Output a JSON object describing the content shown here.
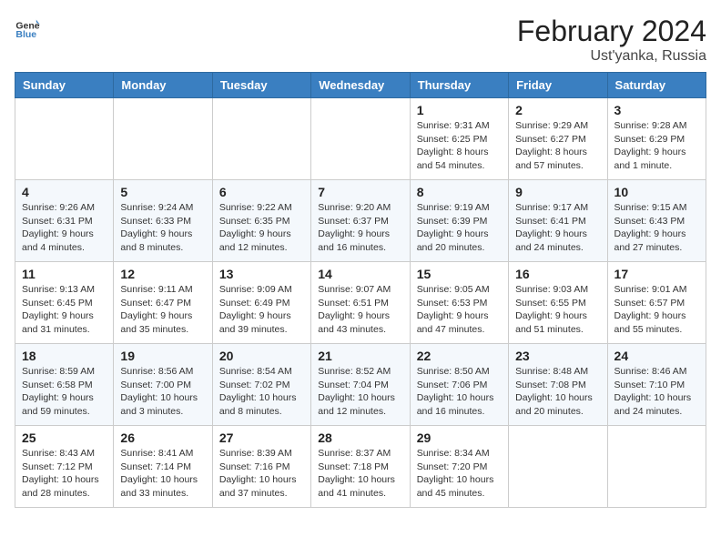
{
  "header": {
    "logo": {
      "general": "General",
      "blue": "Blue"
    },
    "title": "February 2024",
    "subtitle": "Ust'yanka, Russia"
  },
  "days_of_week": [
    "Sunday",
    "Monday",
    "Tuesday",
    "Wednesday",
    "Thursday",
    "Friday",
    "Saturday"
  ],
  "weeks": [
    [
      {
        "date": "",
        "sunrise": "",
        "sunset": "",
        "daylight": ""
      },
      {
        "date": "",
        "sunrise": "",
        "sunset": "",
        "daylight": ""
      },
      {
        "date": "",
        "sunrise": "",
        "sunset": "",
        "daylight": ""
      },
      {
        "date": "",
        "sunrise": "",
        "sunset": "",
        "daylight": ""
      },
      {
        "date": "1",
        "sunrise": "9:31 AM",
        "sunset": "6:25 PM",
        "daylight": "8 hours and 54 minutes."
      },
      {
        "date": "2",
        "sunrise": "9:29 AM",
        "sunset": "6:27 PM",
        "daylight": "8 hours and 57 minutes."
      },
      {
        "date": "3",
        "sunrise": "9:28 AM",
        "sunset": "6:29 PM",
        "daylight": "9 hours and 1 minute."
      }
    ],
    [
      {
        "date": "4",
        "sunrise": "9:26 AM",
        "sunset": "6:31 PM",
        "daylight": "9 hours and 4 minutes."
      },
      {
        "date": "5",
        "sunrise": "9:24 AM",
        "sunset": "6:33 PM",
        "daylight": "9 hours and 8 minutes."
      },
      {
        "date": "6",
        "sunrise": "9:22 AM",
        "sunset": "6:35 PM",
        "daylight": "9 hours and 12 minutes."
      },
      {
        "date": "7",
        "sunrise": "9:20 AM",
        "sunset": "6:37 PM",
        "daylight": "9 hours and 16 minutes."
      },
      {
        "date": "8",
        "sunrise": "9:19 AM",
        "sunset": "6:39 PM",
        "daylight": "9 hours and 20 minutes."
      },
      {
        "date": "9",
        "sunrise": "9:17 AM",
        "sunset": "6:41 PM",
        "daylight": "9 hours and 24 minutes."
      },
      {
        "date": "10",
        "sunrise": "9:15 AM",
        "sunset": "6:43 PM",
        "daylight": "9 hours and 27 minutes."
      }
    ],
    [
      {
        "date": "11",
        "sunrise": "9:13 AM",
        "sunset": "6:45 PM",
        "daylight": "9 hours and 31 minutes."
      },
      {
        "date": "12",
        "sunrise": "9:11 AM",
        "sunset": "6:47 PM",
        "daylight": "9 hours and 35 minutes."
      },
      {
        "date": "13",
        "sunrise": "9:09 AM",
        "sunset": "6:49 PM",
        "daylight": "9 hours and 39 minutes."
      },
      {
        "date": "14",
        "sunrise": "9:07 AM",
        "sunset": "6:51 PM",
        "daylight": "9 hours and 43 minutes."
      },
      {
        "date": "15",
        "sunrise": "9:05 AM",
        "sunset": "6:53 PM",
        "daylight": "9 hours and 47 minutes."
      },
      {
        "date": "16",
        "sunrise": "9:03 AM",
        "sunset": "6:55 PM",
        "daylight": "9 hours and 51 minutes."
      },
      {
        "date": "17",
        "sunrise": "9:01 AM",
        "sunset": "6:57 PM",
        "daylight": "9 hours and 55 minutes."
      }
    ],
    [
      {
        "date": "18",
        "sunrise": "8:59 AM",
        "sunset": "6:58 PM",
        "daylight": "9 hours and 59 minutes."
      },
      {
        "date": "19",
        "sunrise": "8:56 AM",
        "sunset": "7:00 PM",
        "daylight": "10 hours and 3 minutes."
      },
      {
        "date": "20",
        "sunrise": "8:54 AM",
        "sunset": "7:02 PM",
        "daylight": "10 hours and 8 minutes."
      },
      {
        "date": "21",
        "sunrise": "8:52 AM",
        "sunset": "7:04 PM",
        "daylight": "10 hours and 12 minutes."
      },
      {
        "date": "22",
        "sunrise": "8:50 AM",
        "sunset": "7:06 PM",
        "daylight": "10 hours and 16 minutes."
      },
      {
        "date": "23",
        "sunrise": "8:48 AM",
        "sunset": "7:08 PM",
        "daylight": "10 hours and 20 minutes."
      },
      {
        "date": "24",
        "sunrise": "8:46 AM",
        "sunset": "7:10 PM",
        "daylight": "10 hours and 24 minutes."
      }
    ],
    [
      {
        "date": "25",
        "sunrise": "8:43 AM",
        "sunset": "7:12 PM",
        "daylight": "10 hours and 28 minutes."
      },
      {
        "date": "26",
        "sunrise": "8:41 AM",
        "sunset": "7:14 PM",
        "daylight": "10 hours and 33 minutes."
      },
      {
        "date": "27",
        "sunrise": "8:39 AM",
        "sunset": "7:16 PM",
        "daylight": "10 hours and 37 minutes."
      },
      {
        "date": "28",
        "sunrise": "8:37 AM",
        "sunset": "7:18 PM",
        "daylight": "10 hours and 41 minutes."
      },
      {
        "date": "29",
        "sunrise": "8:34 AM",
        "sunset": "7:20 PM",
        "daylight": "10 hours and 45 minutes."
      },
      {
        "date": "",
        "sunrise": "",
        "sunset": "",
        "daylight": ""
      },
      {
        "date": "",
        "sunrise": "",
        "sunset": "",
        "daylight": ""
      }
    ]
  ]
}
